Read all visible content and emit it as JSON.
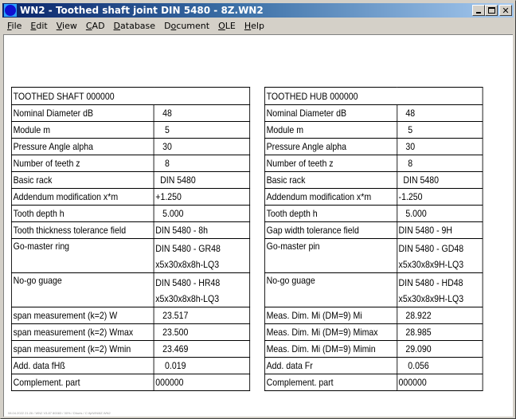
{
  "window": {
    "title": "WN2 - Toothed shaft joint DIN 5480  -  8Z.WN2",
    "icon": "gear-app-icon",
    "caption_buttons": [
      "minimize",
      "maximize",
      "close"
    ]
  },
  "menubar": {
    "items": [
      {
        "label": "File",
        "mnemonic": "F",
        "rest": "ile"
      },
      {
        "label": "Edit",
        "mnemonic": "E",
        "rest": "dit"
      },
      {
        "label": "View",
        "mnemonic": "V",
        "rest": "iew"
      },
      {
        "label": "CAD",
        "mnemonic": "C",
        "rest": "AD"
      },
      {
        "label": "Database",
        "mnemonic": "D",
        "rest": "atabase"
      },
      {
        "label": "Document",
        "mnemonic_pre": "D",
        "mnemonic": "o",
        "rest": "cument"
      },
      {
        "label": "OLE",
        "mnemonic": "O",
        "rest": "LE"
      },
      {
        "label": "Help",
        "mnemonic": "H",
        "rest": "elp"
      }
    ]
  },
  "shaft": {
    "title": "TOOTHED SHAFT 000000",
    "rows": [
      {
        "label": "Nominal Diameter dB",
        "value": "   48"
      },
      {
        "label": "Module m",
        "value": "    5"
      },
      {
        "label": "Pressure Angle alpha",
        "value": "   30"
      },
      {
        "label": "Number of teeth z",
        "value": "    8"
      },
      {
        "label": "Basic rack",
        "value": "  DIN 5480"
      },
      {
        "label": "Addendum modification x*m",
        "value": "+1.250"
      },
      {
        "label": "Tooth depth h",
        "value": "   5.000"
      },
      {
        "label": "Tooth thickness tolerance field",
        "value": "DIN 5480 - 8h"
      },
      {
        "label": "Go-master ring",
        "value": "DIN 5480 - GR48",
        "value2": "x5x30x8x8h-LQ3"
      },
      {
        "label": "No-go guage",
        "value": "DIN 5480 - HR48",
        "value2": "x5x30x8x8h-LQ3"
      },
      {
        "label": "span measurement (k=2) W",
        "value": "   23.517"
      },
      {
        "label": "span measurement (k=2) Wmax",
        "value": "   23.500"
      },
      {
        "label": "span measurement (k=2) Wmin",
        "value": "   23.469"
      },
      {
        "label": "Add. data fHß",
        "value": "    0.019"
      },
      {
        "label": "Complement. part",
        "value": "000000"
      }
    ]
  },
  "hub": {
    "title": "TOOTHED HUB 000000",
    "rows": [
      {
        "label": "Nominal Diameter dB",
        "value": "   48"
      },
      {
        "label": "Module m",
        "value": "    5"
      },
      {
        "label": "Pressure Angle alpha",
        "value": "   30"
      },
      {
        "label": "Number of teeth z",
        "value": "    8"
      },
      {
        "label": "Basic rack",
        "value": "  DIN 5480"
      },
      {
        "label": "Addendum modification x*m",
        "value": "-1.250"
      },
      {
        "label": "Tooth depth h",
        "value": "   5.000"
      },
      {
        "label": "Gap width tolerance field",
        "value": "DIN 5480 - 9H"
      },
      {
        "label": "Go-master pin",
        "value": "DIN 5480 - GD48",
        "value2": "x5x30x8x9H-LQ3"
      },
      {
        "label": "No-go guage",
        "value": "DIN 5480 - HD48",
        "value2": "x5x30x8x9H-LQ3"
      },
      {
        "label": "Meas. Dim. Mi (DM=9) Mi",
        "value": "   28.922"
      },
      {
        "label": "Meas. Dim. Mi (DM=9) Mimax",
        "value": "   28.985"
      },
      {
        "label": "Meas. Dim. Mi (DM=9) Mimin",
        "value": "   29.090"
      },
      {
        "label": "Add. data Fr",
        "value": "    0.056"
      },
      {
        "label": "Complement. part",
        "value": "000000"
      }
    ]
  },
  "footer": {
    "text": "08.04.2022 21:26 / WN2 V3.87 80083 / 30% / Dhuris / C:\\fp\\WN\\8Z.WN2"
  }
}
